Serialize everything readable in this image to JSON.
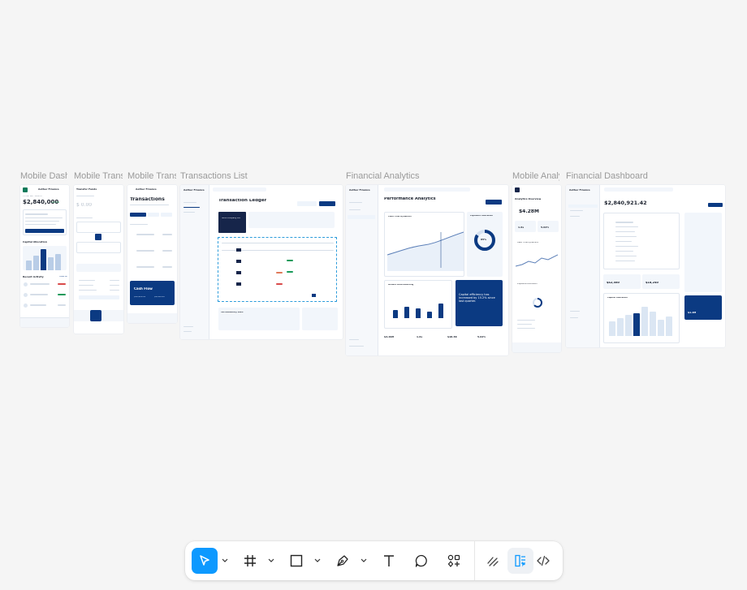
{
  "frames": [
    {
      "label": "Mobile Dashboard",
      "brand": "Aether Finance",
      "total_label": "TOTAL NET WORTH",
      "total_value": "$2,840,000",
      "delta": "+4.2%",
      "section_allocation": "Capital Allocation",
      "section_activity": "Recent Activity",
      "view_all": "View All"
    },
    {
      "label": "Mobile Transfer",
      "title": "Transfer Funds",
      "amount": "$ 0.00",
      "cta": "Confirm Transfer"
    },
    {
      "label": "Mobile Transactions",
      "brand": "Aether Finance",
      "title": "Transactions",
      "card_title": "Cash Flow",
      "v1": "$18,420.00",
      "v2": "$9,610.00"
    },
    {
      "label": "Transactions List",
      "brand": "Aether Finance",
      "title": "Transaction Ledger",
      "promo": "Sora Company Ltd",
      "btn": "+ New Entry",
      "footer_title": "Tax Residency Docs"
    },
    {
      "label": "Financial Analytics",
      "brand": "Aether Finance",
      "title": "Performance Analytics",
      "card1": "Cash Flow Dynamics",
      "card2": "Exposure Allocation",
      "card3": "Growth Benchmarking",
      "promo": "Capital efficiency has increased by 15.2% since last quarter.",
      "donut": "85%",
      "k1": "$4.29M",
      "k2": "1.6x",
      "k3": "$18.3K",
      "k4": "5.02%"
    },
    {
      "label": "Mobile Analytics",
      "title": "Analytics Overview",
      "value": "$4.28M",
      "k1": "1.6x",
      "k2": "5.02%",
      "chart": "Cash Flow Dynamics",
      "alloc": "Exposure Allocation"
    },
    {
      "label": "Financial Dashboard",
      "brand": "Aether Finance",
      "total": "$2,840,921.42",
      "chart_title": "Capital Allocation",
      "v1": "$42,580",
      "v2": "$18,240",
      "promo": "$1.2M"
    }
  ],
  "toolbar": {
    "tools": [
      {
        "name": "move-tool",
        "active": true
      },
      {
        "name": "frame-tool"
      },
      {
        "name": "rectangle-tool"
      },
      {
        "name": "pen-tool"
      },
      {
        "name": "text-tool"
      },
      {
        "name": "comment-tool"
      },
      {
        "name": "components-tool"
      },
      {
        "name": "draw-mode"
      },
      {
        "name": "design-mode",
        "selected": true
      },
      {
        "name": "dev-mode"
      }
    ],
    "accent": "#0d99ff"
  }
}
